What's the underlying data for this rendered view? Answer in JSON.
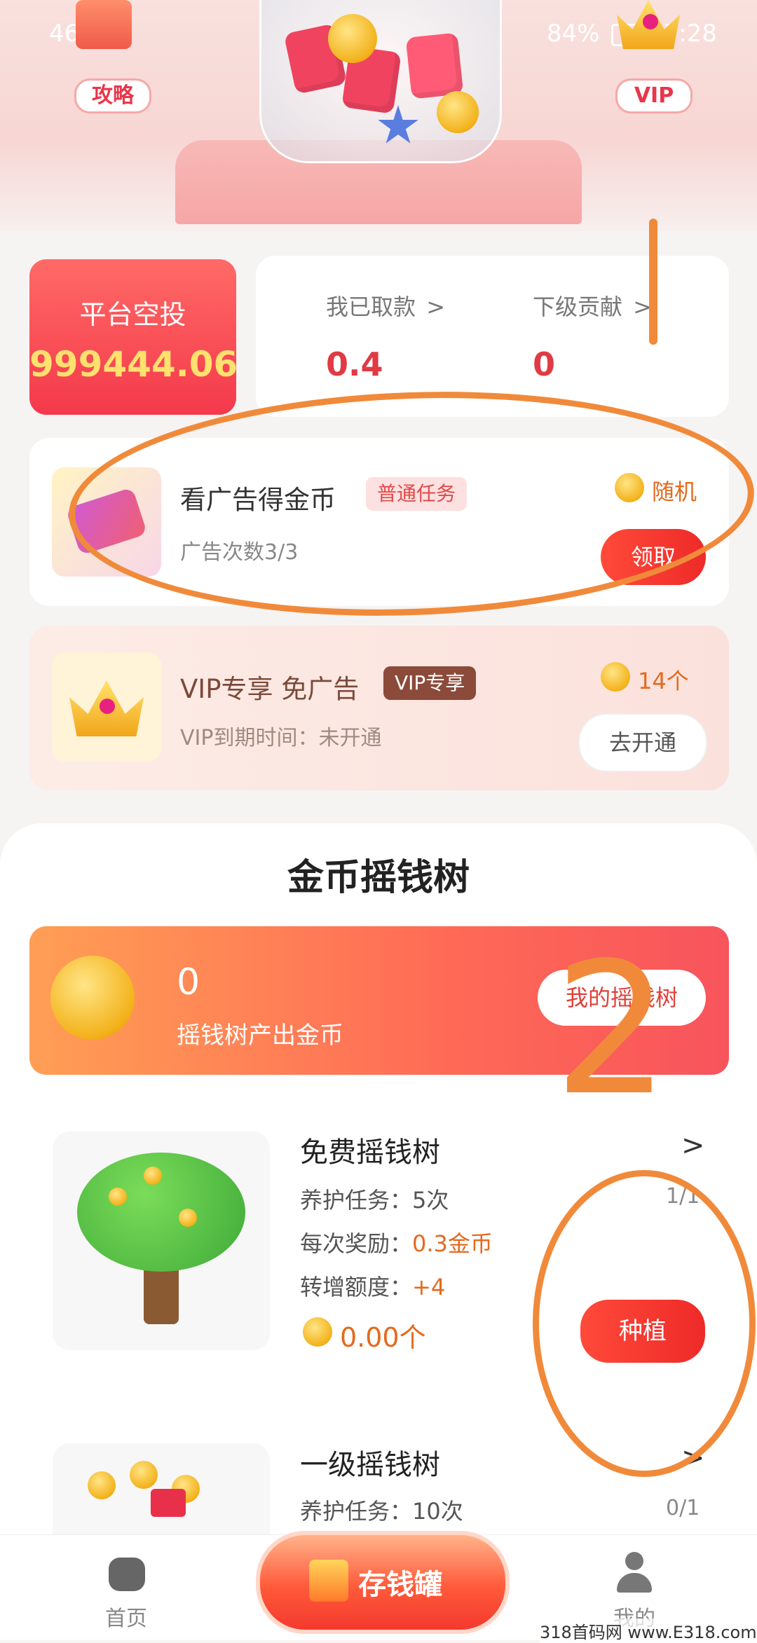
{
  "status_bar": {
    "network": "46",
    "battery": "84%",
    "time": "17:28"
  },
  "header": {
    "guide_label": "攻略",
    "vip_label": "VIP"
  },
  "airdrop": {
    "title": "平台空投",
    "value": "999444.06"
  },
  "stats": {
    "withdrawn_label": "我已取款",
    "withdrawn_value": "0.4",
    "contribution_label": "下级贡献",
    "contribution_value": "0"
  },
  "ad_task": {
    "title": "看广告得金币",
    "tag": "普通任务",
    "sub": "广告次数3/3",
    "reward": "随机",
    "button": "领取"
  },
  "vip_task": {
    "title": "VIP专享 免广告",
    "tag": "VIP专享",
    "sub": "VIP到期时间：未开通",
    "reward": "14个",
    "button": "去开通"
  },
  "money_tree": {
    "section_title": "金币摇钱树",
    "banner_value": "0",
    "banner_label": "摇钱树产出金币",
    "banner_button": "我的摇钱树"
  },
  "trees": [
    {
      "name": "免费摇钱树",
      "progress": "1/1",
      "care_label": "养护任务：",
      "care_value": "5次",
      "reward_label": "每次奖励：",
      "reward_value": "0.3金币",
      "quota_label": "转增额度：",
      "quota_value": "+4",
      "coins": "0.00个",
      "button": "种植"
    },
    {
      "name": "一级摇钱树",
      "progress": "0/1",
      "care_label": "养护任务：",
      "care_value": "10次"
    }
  ],
  "nav": {
    "home": "首页",
    "center": "存钱罐",
    "mine": "我的"
  },
  "watermark": "318首码网 www.E318.com",
  "colors": {
    "accent": "#f4394b",
    "orange_annotation": "#f08a3a"
  }
}
